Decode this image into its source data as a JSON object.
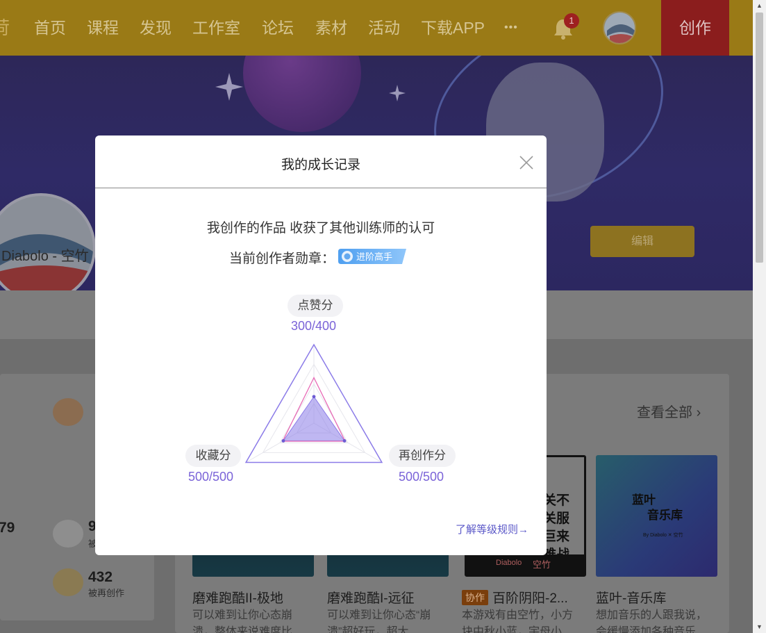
{
  "nav": {
    "items": [
      "首页",
      "课程",
      "发现",
      "工作室",
      "论坛",
      "素材",
      "活动",
      "下载APP"
    ],
    "more_label": "•••",
    "notification_count": "1",
    "create_label": "创作",
    "colors": {
      "bar": "#d2a521",
      "create": "#c62828"
    }
  },
  "profile": {
    "edit_label": "编辑",
    "avatar_caption": "Diabolo - 空竹"
  },
  "stats": [
    {
      "value": "79",
      "label": ""
    },
    {
      "value": "9",
      "label": "被"
    },
    {
      "value": "432",
      "label": "被再创作"
    }
  ],
  "works": {
    "view_all_label": "查看全部",
    "items": [
      {
        "title": "磨难跑酷II-极地",
        "desc": "可以难到让你心态崩溃，整体来说难度比",
        "collab": ""
      },
      {
        "title": "磨难跑酷I-远征",
        "desc": "可以难到让你心态“崩溃”超好玩，超大",
        "collab": ""
      },
      {
        "title": "百阶阴阳-2...",
        "desc": "本游戏有由空竹，小方块中秋小蓝，宇母小",
        "collab": "协作"
      },
      {
        "title": "蓝叶-音乐库",
        "desc": "想加音乐的人跟我说，会缓慢添加各种音乐",
        "collab": ""
      }
    ],
    "thumb3_text": [
      "关不",
      "关服",
      "巨来",
      "难战",
      "Diabolo",
      "空竹"
    ],
    "thumb4_text": [
      "蓝叶",
      "音乐库",
      "By Diabolo ✕ 空竹"
    ]
  },
  "modal": {
    "title": "我的成长记录",
    "line1": "我创作的作品 收获了其他训练师的认可",
    "badge_prefix": "当前创作者勋章：",
    "badge_name": "进阶高手",
    "rules_link": "了解等级规则→",
    "radar": {
      "axes": [
        {
          "label": "点赞分",
          "score": "300/400",
          "value": 300,
          "max": 400
        },
        {
          "label": "收藏分",
          "score": "500/500",
          "value": 500,
          "max": 500
        },
        {
          "label": "再创作分",
          "score": "500/500",
          "value": 500,
          "max": 500
        }
      ],
      "accent": "#8b7be8"
    }
  }
}
